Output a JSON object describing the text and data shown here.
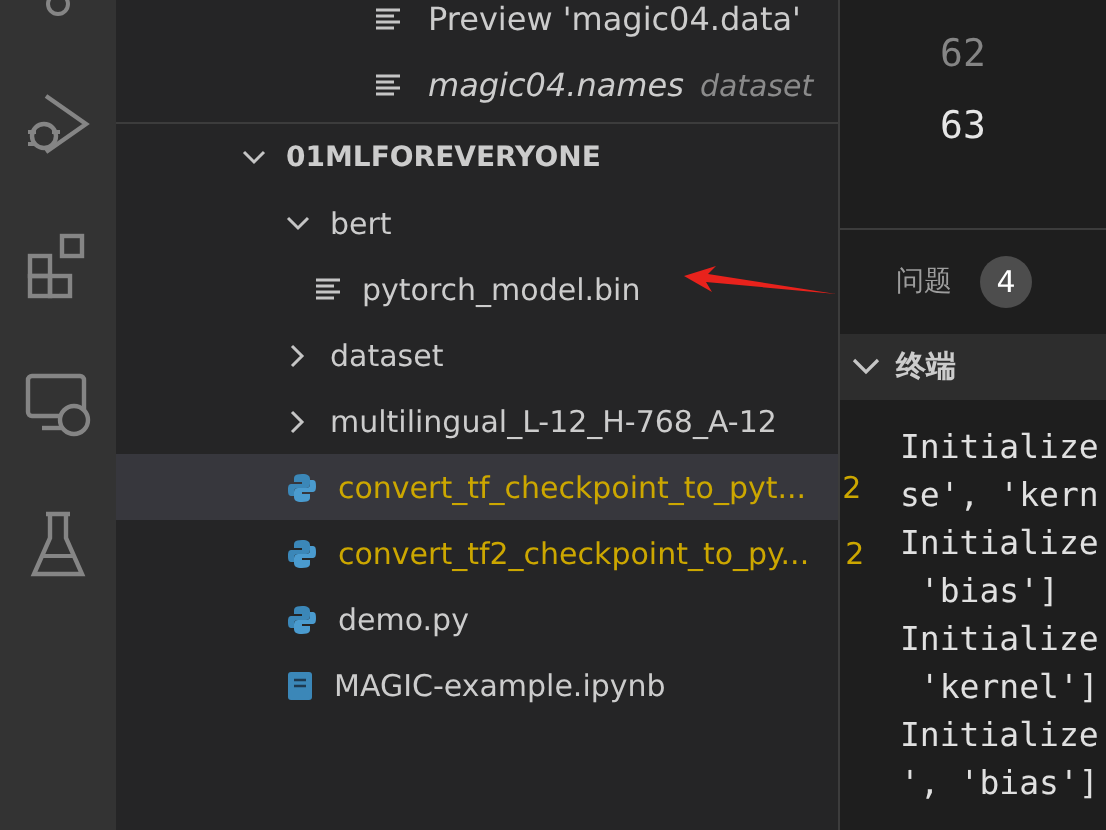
{
  "outline": [
    {
      "label": "Preview 'magic04.data'",
      "italic": false
    },
    {
      "label": "magic04.names",
      "description": "dataset",
      "italic": true
    }
  ],
  "explorer": {
    "title": "01MLFOREVERYONE",
    "expanded": true,
    "items": [
      {
        "kind": "folder",
        "label": "bert",
        "expanded": true,
        "selected": false,
        "warning": false,
        "children": [
          {
            "kind": "text-file",
            "label": "pytorch_model.bin",
            "selected": false,
            "warning": false
          }
        ]
      },
      {
        "kind": "folder",
        "label": "dataset",
        "expanded": false,
        "selected": false,
        "warning": false
      },
      {
        "kind": "folder",
        "label": "multilingual_L-12_H-768_A-12",
        "expanded": false,
        "selected": false,
        "warning": false
      },
      {
        "kind": "python",
        "label": "convert_tf_checkpoint_to_pyt...",
        "badge": "2",
        "selected": true,
        "warning": true
      },
      {
        "kind": "python",
        "label": "convert_tf2_checkpoint_to_py...",
        "badge": "2",
        "selected": false,
        "warning": true
      },
      {
        "kind": "python",
        "label": "demo.py",
        "selected": false,
        "warning": false
      },
      {
        "kind": "notebook",
        "label": "MAGIC-example.ipynb",
        "selected": false,
        "warning": false
      }
    ]
  },
  "editor": {
    "line_numbers": [
      {
        "number": "62",
        "current": false
      },
      {
        "number": "63",
        "current": true
      }
    ]
  },
  "panel": {
    "tabs": [
      {
        "label": "问题",
        "badge": "4"
      }
    ],
    "section": {
      "title": "终端",
      "expanded": true
    },
    "terminal_lines": [
      "Initialize",
      "se', 'kern",
      "Initialize",
      " 'bias']",
      "Initialize",
      " 'kernel']",
      "Initialize",
      "', 'bias']"
    ]
  }
}
